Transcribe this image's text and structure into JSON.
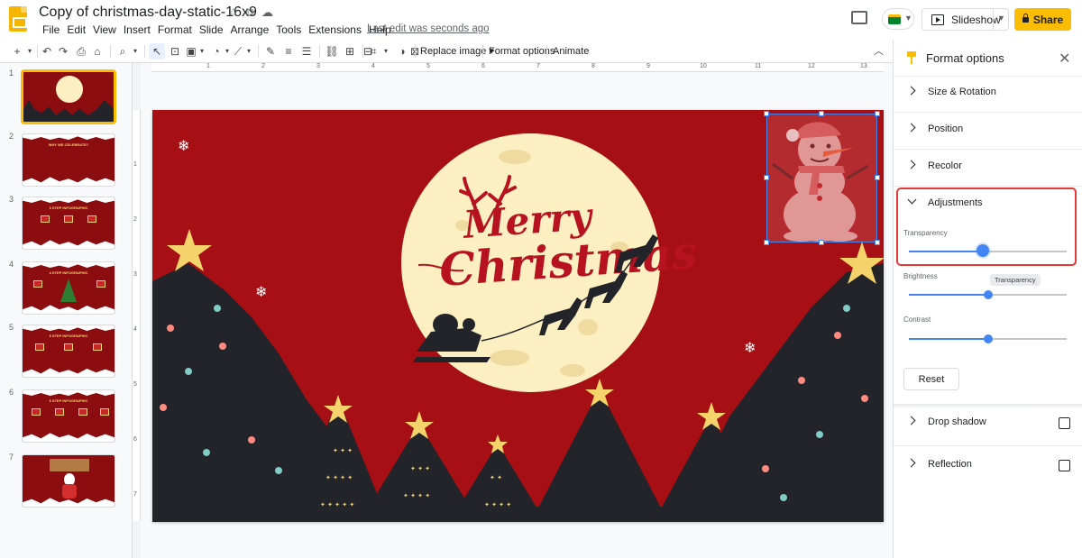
{
  "header": {
    "doc_title": "Copy of christmas-day-static-16x9",
    "menu": [
      "File",
      "Edit",
      "View",
      "Insert",
      "Format",
      "Slide",
      "Arrange",
      "Tools",
      "Extensions",
      "Help"
    ],
    "last_edit": "Last edit was seconds ago",
    "slideshow_label": "Slideshow",
    "share_label": "Share",
    "colors": {
      "share_bg": "#fbbc04",
      "accent": "#4285f4",
      "slides_logo": "#f4b400"
    }
  },
  "toolbar": {
    "replace_image_label": "Replace image",
    "format_options_label": "Format options",
    "animate_label": "Animate"
  },
  "filmstrip": {
    "slides": [
      {
        "number": "1",
        "caption": ""
      },
      {
        "number": "2",
        "caption": "WHY WE CELEBRATE?"
      },
      {
        "number": "3",
        "caption": "3 STEP INFOGRAPHIC"
      },
      {
        "number": "4",
        "caption": "4 STEP INFOGRAPHIC"
      },
      {
        "number": "5",
        "caption": "5 STEP INFOGRAPHIC"
      },
      {
        "number": "6",
        "caption": "6 STEP INFOGRAPHIC"
      },
      {
        "number": "7",
        "caption": ""
      }
    ]
  },
  "ruler": {
    "top": [
      "1",
      "2",
      "3",
      "4",
      "5",
      "6",
      "7",
      "8",
      "9",
      "10",
      "11",
      "12",
      "13"
    ],
    "left": [
      "1",
      "2",
      "3",
      "4",
      "5",
      "6",
      "7"
    ]
  },
  "slide": {
    "merry": "Merry",
    "christmas": "Christmas",
    "colors": {
      "background": "#a60f14",
      "moon": "#fcefc2",
      "trees": "#23242a",
      "star": "#f4d36b"
    }
  },
  "format_panel": {
    "title": "Format options",
    "sections": {
      "size_rotation": "Size & Rotation",
      "position": "Position",
      "recolor": "Recolor",
      "adjustments": "Adjustments",
      "drop_shadow": "Drop shadow",
      "reflection": "Reflection"
    },
    "adjustments": {
      "transparency_label": "Transparency",
      "transparency_value": 0.47,
      "brightness_label": "Brightness",
      "brightness_value": 0.5,
      "contrast_label": "Contrast",
      "contrast_value": 0.5,
      "tooltip": "Transparency",
      "reset_label": "Reset"
    },
    "drop_shadow_checked": false,
    "reflection_checked": false
  }
}
